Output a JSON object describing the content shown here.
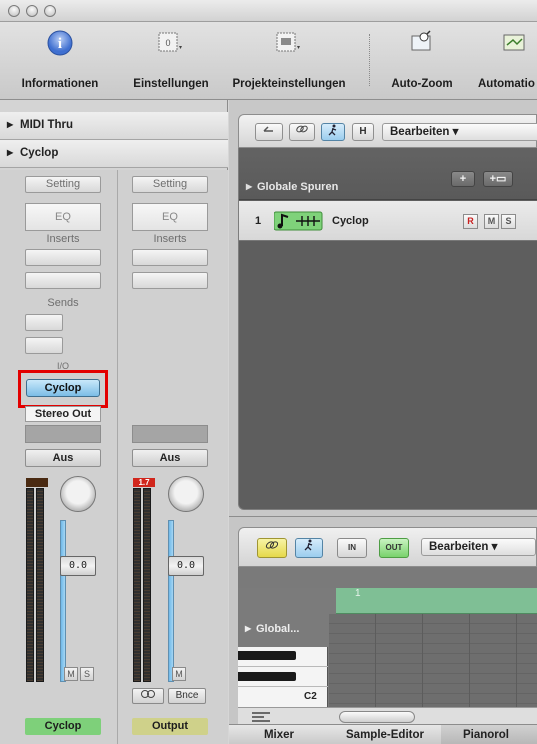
{
  "window": {
    "controls": [
      "close",
      "minimize",
      "zoom"
    ]
  },
  "toolbar": {
    "items": [
      {
        "label": "Informationen",
        "icon": "info-icon"
      },
      {
        "label": "Einstellungen",
        "icon": "settings-icon"
      },
      {
        "label": "Projekteinstellungen",
        "icon": "project-settings-icon"
      },
      {
        "label": "Auto-Zoom",
        "icon": "auto-zoom-icon"
      },
      {
        "label": "Automatio",
        "icon": "automation-icon"
      }
    ]
  },
  "mixer": {
    "sections": [
      "MIDI Thru",
      "Cyclop"
    ],
    "channel1": {
      "setting": "Setting",
      "eq": "EQ",
      "inserts": "Inserts",
      "sends": "Sends",
      "io_label": "I/O",
      "input": "Cyclop",
      "output": "Stereo Out",
      "automation": "Aus",
      "volume": "0.0",
      "mute": "M",
      "solo": "S",
      "name": "Cyclop"
    },
    "channel2": {
      "setting": "Setting",
      "eq": "EQ",
      "inserts": "Inserts",
      "automation": "Aus",
      "peak": "1.7",
      "volume": "0.0",
      "mute": "M",
      "bounce": "Bnce",
      "name": "Output"
    }
  },
  "arrange": {
    "toolbar": {
      "edit_menu": "Bearbeiten",
      "hide_btn": "H"
    },
    "global_tracks": "Globale Spuren",
    "tracks": [
      {
        "number": "1",
        "name": "Cyclop",
        "r": "R",
        "m": "M",
        "s": "S"
      }
    ]
  },
  "piano_roll": {
    "edit_menu": "Bearbeiten",
    "buttons": {
      "in": "IN",
      "out": "OUT"
    },
    "global_label": "Global...",
    "ruler_start": "1",
    "note_label": "C2"
  },
  "tabs": [
    "Mixer",
    "Sample-Editor",
    "Pianorol"
  ],
  "colors": {
    "io_button": "#7cbde6",
    "highlight": "#e30000",
    "region_green": "#7fbf95",
    "cyclop_pill": "#7ed07a",
    "output_pill": "#cfd18a"
  }
}
